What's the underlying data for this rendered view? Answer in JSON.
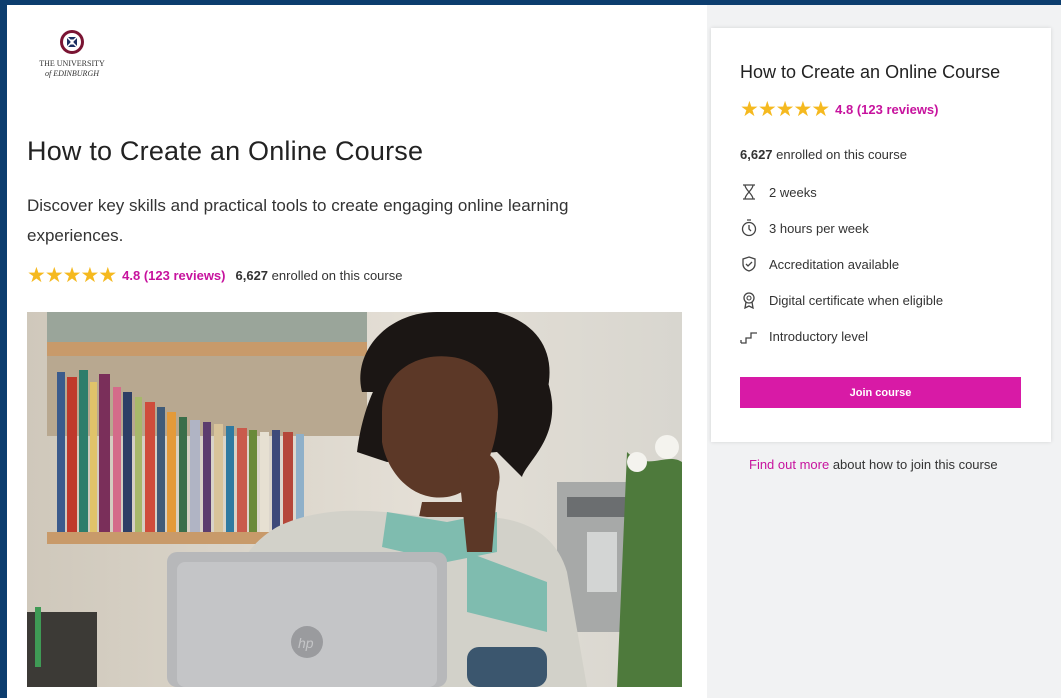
{
  "logo": {
    "line1": "THE UNIVERSITY",
    "line2": "of EDINBURGH",
    "icon": "university-crest-icon"
  },
  "course": {
    "title": "How to Create an Online Course",
    "description": "Discover key skills and practical tools to create engaging online learning experiences.",
    "rating_text": "4.8 (123 reviews)",
    "stars": 5,
    "enrolled_count": "6,627",
    "enrolled_suffix": "enrolled on this course"
  },
  "card": {
    "title": "How to Create an Online Course",
    "rating_text": "4.8 (123 reviews)",
    "enrolled_count": "6,627",
    "enrolled_suffix": "enrolled on this course",
    "details": [
      {
        "icon": "hourglass-icon",
        "text": "2 weeks"
      },
      {
        "icon": "stopwatch-icon",
        "text": "3 hours per week"
      },
      {
        "icon": "shield-check-icon",
        "text": "Accreditation available"
      },
      {
        "icon": "certificate-icon",
        "text": "Digital certificate when eligible"
      },
      {
        "icon": "steps-icon",
        "text": "Introductory level"
      }
    ],
    "join_label": "Join course"
  },
  "find_more": {
    "link": "Find out more",
    "rest": "about how to join this course"
  },
  "colors": {
    "accent": "#d81aa6",
    "rating": "#c7139e",
    "star": "#f5b91f",
    "frame": "#0c3d6e"
  }
}
